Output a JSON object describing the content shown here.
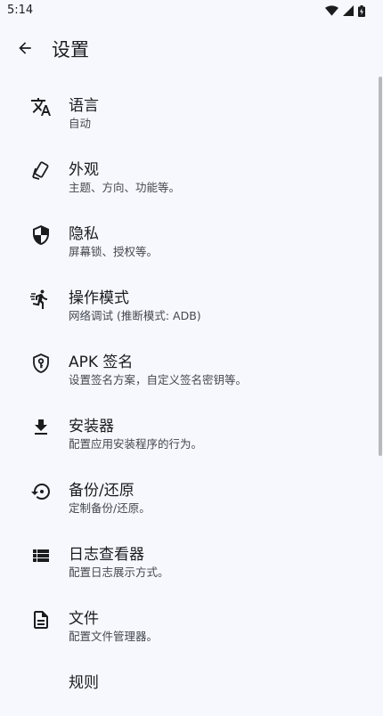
{
  "status_bar": {
    "time": "5:14"
  },
  "app_bar": {
    "title": "设置"
  },
  "settings": [
    {
      "icon": "translate-icon",
      "title": "语言",
      "subtitle": "自动"
    },
    {
      "icon": "appearance-icon",
      "title": "外观",
      "subtitle": "主题、方向、功能等。"
    },
    {
      "icon": "shield-icon",
      "title": "隐私",
      "subtitle": "屏幕锁、授权等。"
    },
    {
      "icon": "run-mode-icon",
      "title": "操作模式",
      "subtitle": "网络调试 (推断模式: ADB)"
    },
    {
      "icon": "key-shield-icon",
      "title": "APK 签名",
      "subtitle": "设置签名方案，自定义签名密钥等。"
    },
    {
      "icon": "download-icon",
      "title": "安装器",
      "subtitle": "配置应用安装程序的行为。"
    },
    {
      "icon": "restore-icon",
      "title": "备份/还原",
      "subtitle": "定制备份/还原。"
    },
    {
      "icon": "list-icon",
      "title": "日志查看器",
      "subtitle": "配置日志展示方式。"
    },
    {
      "icon": "file-icon",
      "title": "文件",
      "subtitle": "配置文件管理器。"
    },
    {
      "icon": "rules-icon",
      "title": "规则",
      "subtitle": ""
    }
  ]
}
